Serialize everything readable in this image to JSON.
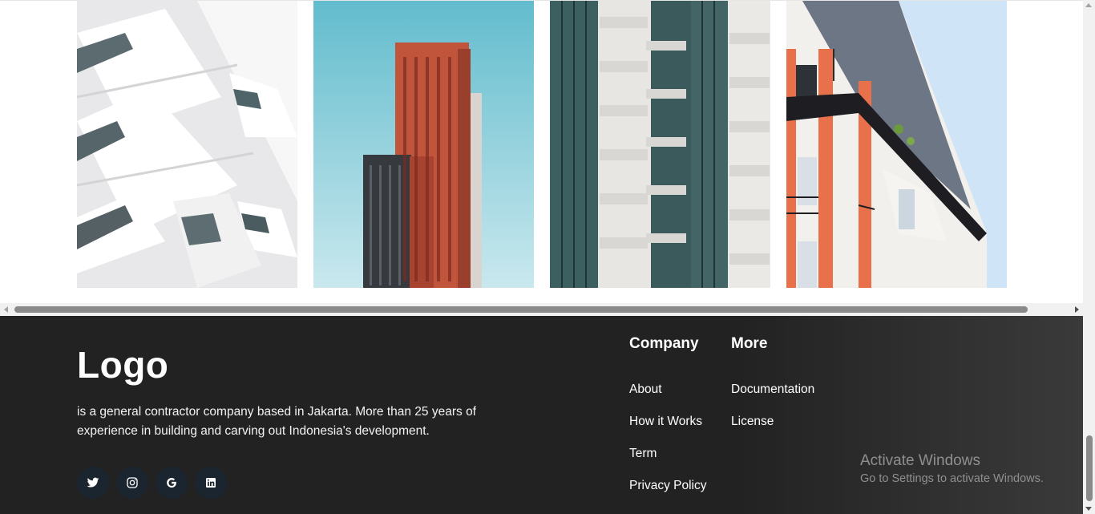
{
  "footer": {
    "logo": "Logo",
    "description": "is a general contractor company based in Jakarta. More than 25 years of experience in building and carving out Indonesia's development.",
    "socials": [
      "twitter-icon",
      "instagram-icon",
      "google-icon",
      "linkedin-icon"
    ],
    "company": {
      "title": "Company",
      "links": [
        "About",
        "How it Works",
        "Term",
        "Privacy Policy"
      ]
    },
    "more": {
      "title": "More",
      "links": [
        "Documentation",
        "License"
      ]
    }
  },
  "watermark": {
    "line1": "Activate Windows",
    "line2": "Go to Settings to activate Windows."
  },
  "colors": {
    "footer_bg": "#222222",
    "social_bg": "#1b2530",
    "text": "#ffffff"
  }
}
